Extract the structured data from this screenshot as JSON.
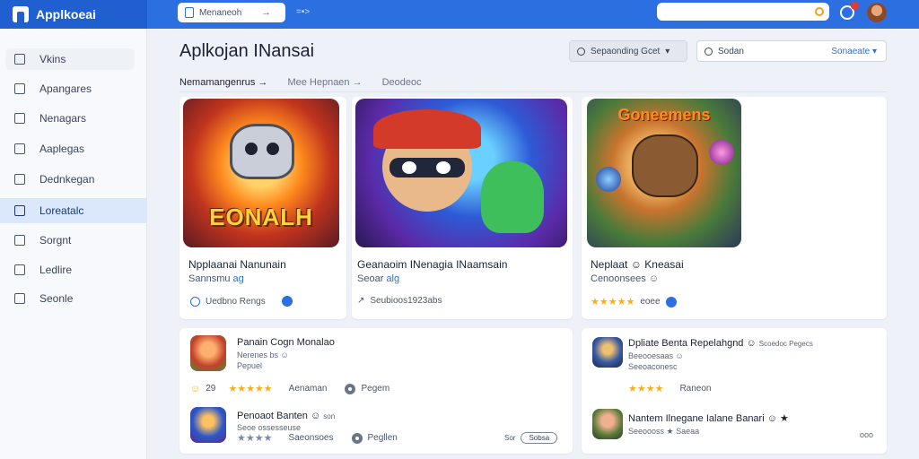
{
  "app": {
    "title": "Applkoeai",
    "tab_label": "Menaneoh",
    "tab_arrow": "→",
    "top_extra": "=•>",
    "search_placeholder": ""
  },
  "sidebar": {
    "items": [
      {
        "label": "Vkins",
        "icon": "home-icon"
      },
      {
        "label": "Apangares",
        "icon": "camera-icon"
      },
      {
        "label": "Nenagars",
        "icon": "document-icon"
      },
      {
        "label": "Aaplegas",
        "icon": "folder-icon"
      },
      {
        "label": "Dednkegan",
        "icon": "download-icon"
      },
      {
        "label": "Loreatalc",
        "icon": "chart-icon"
      },
      {
        "label": "Sorgnt",
        "icon": "shield-icon"
      },
      {
        "label": "Ledlire",
        "icon": "clock-icon"
      },
      {
        "label": "Seonle",
        "icon": "grid-icon"
      }
    ]
  },
  "main": {
    "title": "Aplkojan INansai",
    "sort_label": "Sepaonding Gcet",
    "filter_label": "Sodan",
    "filter_select": "Sonaeate",
    "crumbs": [
      "Nemamangenrus →",
      "Mee Hepnaen →",
      "Deodeoc"
    ]
  },
  "featured": [
    {
      "art_text": "EONALH",
      "title": "Npplaanai Nanunain",
      "subtitle": "Sannsmu",
      "subtitle_link": "ag",
      "meta": "Uedbno Rengs"
    },
    {
      "art_text": "",
      "title": "Geanaoim INenagia INaamsain",
      "subtitle": "Seoar",
      "subtitle_link": "alg",
      "meta": "Seubioos1923abs"
    },
    {
      "art_text": "Goneemens",
      "title": "Neplaat ☺ Kneasai",
      "subtitle": "Cenoonsees ☺",
      "meta_stars": "★★★★★",
      "meta": "eoee"
    }
  ],
  "list_left": [
    {
      "title": "Panain Cogn Monalao",
      "line2": "Nerenes bs ☺",
      "line3": "Pepuel",
      "badge": "29",
      "stars": "★★★★★",
      "col3": "Aenaman",
      "col4": "Pegem"
    },
    {
      "title": "Penoaot Banten ☺",
      "title_suffix": "son",
      "line2": "Seoe ossesseuse",
      "stars": "★★★★",
      "col3": "Saeonsoes",
      "col4": "Pegllen",
      "tag_prefix": "Sor",
      "tag": "Sobsa"
    }
  ],
  "list_right": [
    {
      "title": "Dpliate Benta Repelahgnd ☺",
      "title_suffix": "Scoedoc Pegecs",
      "line2": "Beeooesaas ☺",
      "line3": "Seeoaconesc",
      "stars": "★★★★",
      "col3": "Raneon"
    },
    {
      "title": "Nantem Ilnegane Ialane Banari ☺ ★",
      "line2": "Seeoooss ★ Saeaa",
      "tail": "ooo"
    }
  ],
  "colors": {
    "accent": "#2b6fe0",
    "brand": "#1f5fd0",
    "star": "#f2b01e"
  }
}
